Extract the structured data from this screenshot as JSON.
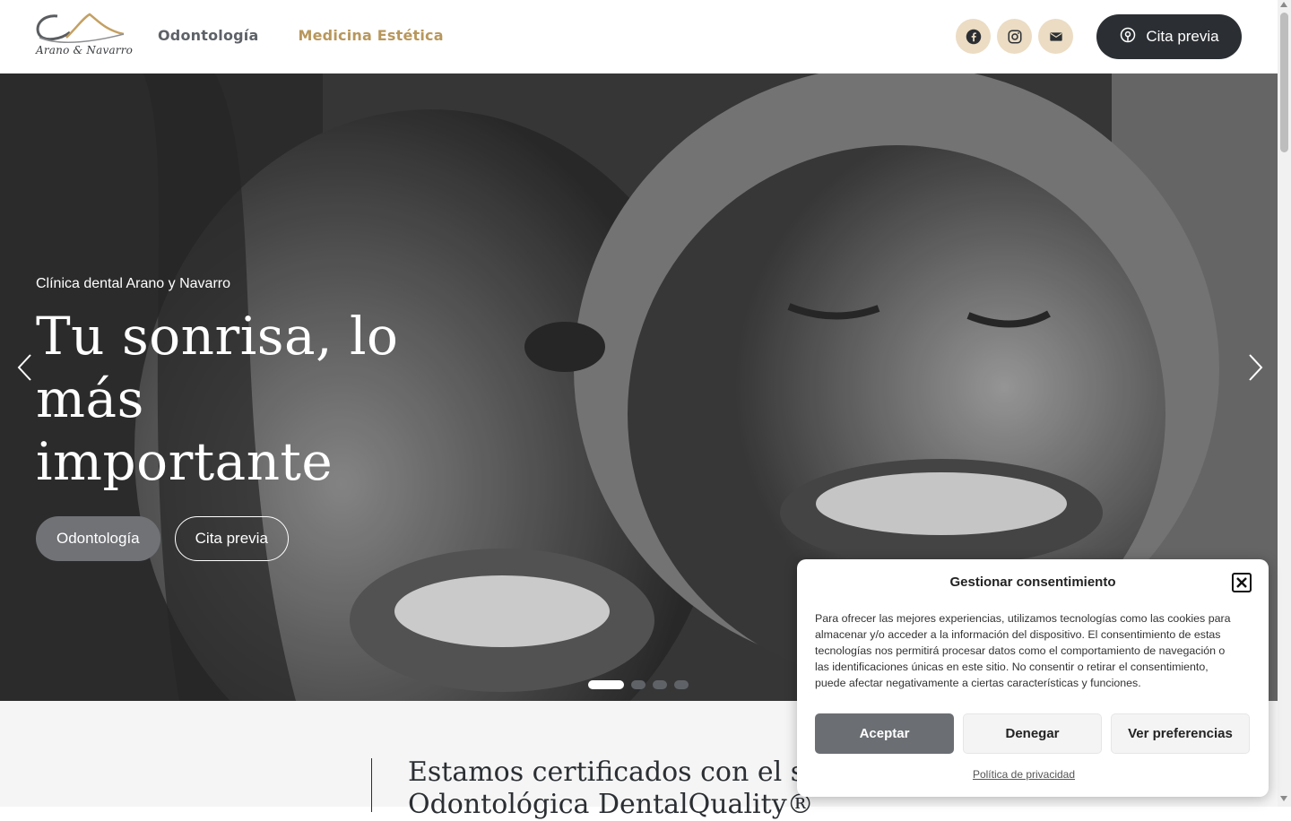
{
  "brand": {
    "name": "Arano & Navarro",
    "colors": {
      "gold": "#b8975c",
      "dark": "#2b2f33",
      "social_bg": "#ebdcc3"
    }
  },
  "nav": {
    "items": [
      {
        "label": "Odontología"
      },
      {
        "label": "Medicina Estética"
      }
    ]
  },
  "social": {
    "icons": [
      "facebook-icon",
      "instagram-icon",
      "mail-icon"
    ]
  },
  "header_cta": {
    "label": "Cita previa",
    "icon": "appointment-icon"
  },
  "hero": {
    "eyebrow": "Clínica dental Arano y Navarro",
    "title": "Tu sonrisa, lo más importante",
    "buttons": [
      {
        "label": "Odontología"
      },
      {
        "label": "Cita previa"
      }
    ],
    "slides_total": 4,
    "active_slide": 1
  },
  "certification": {
    "text": "Estamos certificados con el sello de Excelencia Odontológica DentalQuality®"
  },
  "cookie": {
    "title": "Gestionar consentimiento",
    "body": "Para ofrecer las mejores experiencias, utilizamos tecnologías como las cookies para almacenar y/o acceder a la información del dispositivo. El consentimiento de estas tecnologías nos permitirá procesar datos como el comportamiento de navegación o las identificaciones únicas en este sitio. No consentir o retirar el consentimiento, puede afectar negativamente a ciertas características y funciones.",
    "accept": "Aceptar",
    "deny": "Denegar",
    "preferences": "Ver preferencias",
    "privacy_link": "Política de privacidad"
  }
}
